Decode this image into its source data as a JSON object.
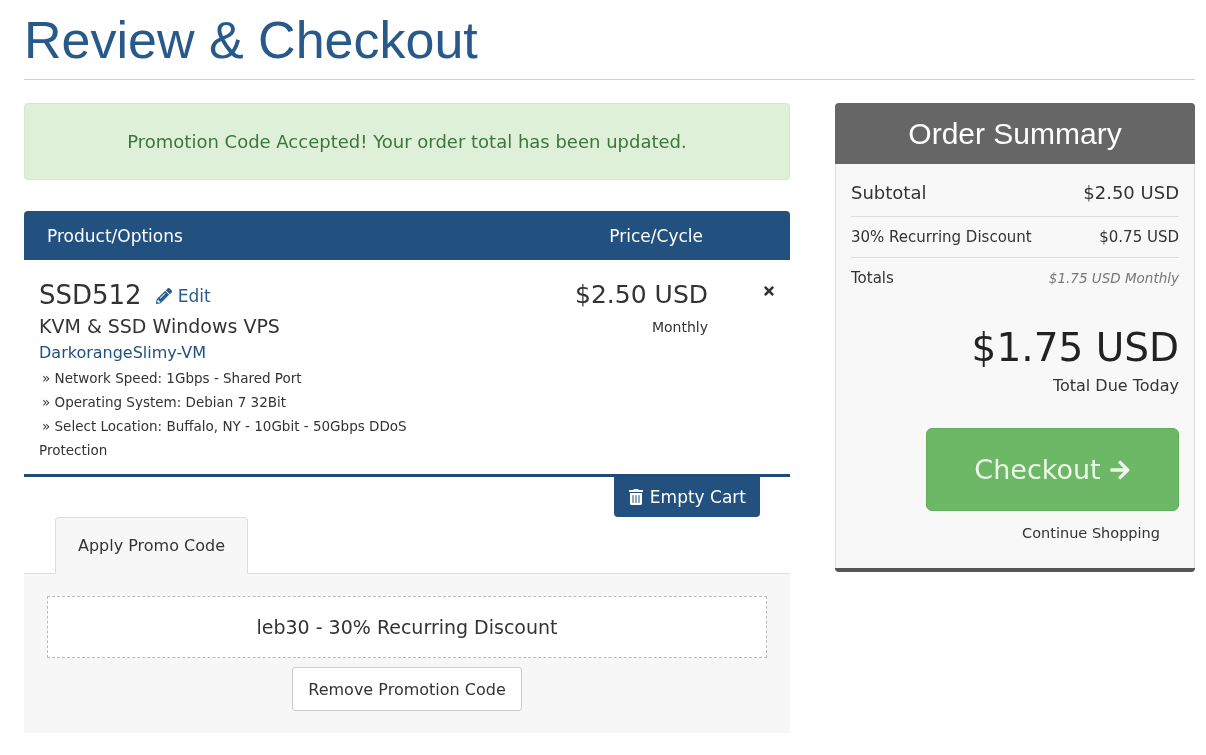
{
  "page": {
    "title": "Review & Checkout"
  },
  "alert": {
    "message": "Promotion Code Accepted! Your order total has been updated."
  },
  "cart": {
    "columns": [
      "Product/Options",
      "Price/Cycle"
    ],
    "items": [
      {
        "name": "SSD512",
        "edit_label": "Edit",
        "group": "KVM & SSD Windows VPS",
        "hostname": "DarkorangeSlimy-VM",
        "options": [
          "» Network Speed: 1Gbps - Shared Port",
          "» Operating System: Debian 7 32Bit",
          "» Select Location: Buffalo, NY - 10Gbit - 50Gbps DDoS Protection"
        ],
        "price": "$2.50 USD",
        "cycle": "Monthly"
      }
    ],
    "empty_cart_button": "Empty Cart"
  },
  "promo": {
    "tabs": [
      {
        "label": "Apply Promo Code",
        "selected": true
      }
    ],
    "applied_code": "leb30 - 30% Recurring Discount",
    "remove_button": "Remove Promotion Code"
  },
  "summary": {
    "title": "Order Summary",
    "lines": [
      {
        "kind": "subtotal",
        "label": "Subtotal",
        "value": "$2.50 USD"
      },
      {
        "kind": "discount",
        "label": "30% Recurring Discount",
        "value": "$0.75 USD"
      },
      {
        "kind": "recurring",
        "label": "Totals",
        "value": "$1.75 USD Monthly"
      }
    ],
    "total_due": "$1.75 USD",
    "total_due_label": "Total Due Today",
    "checkout_button": "Checkout",
    "continue_link": "Continue Shopping"
  }
}
